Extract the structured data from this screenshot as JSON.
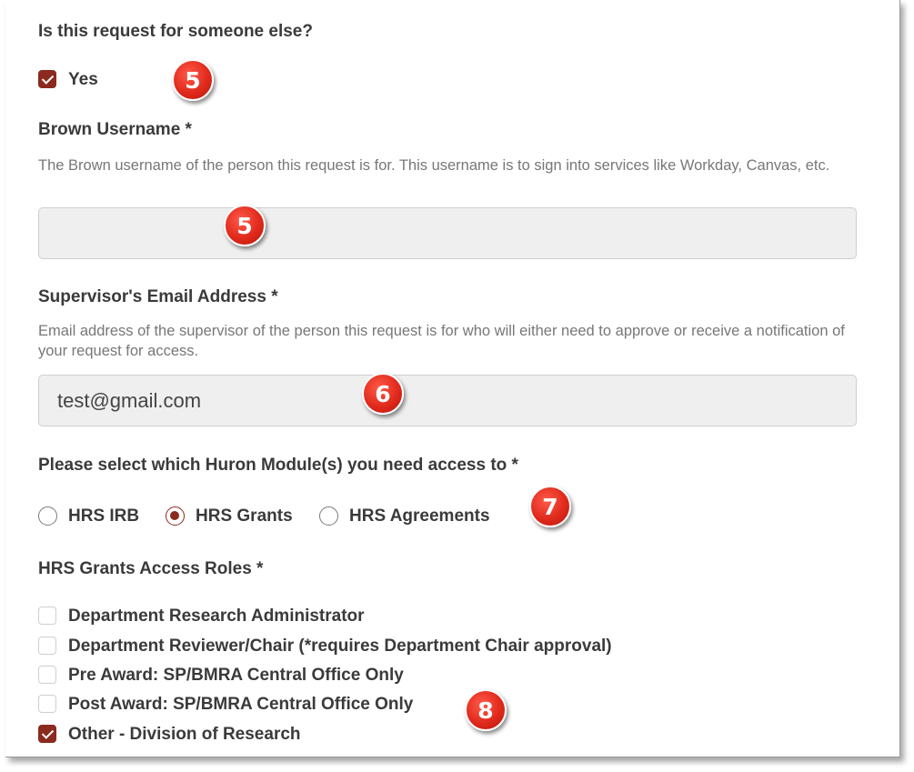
{
  "someone_else": {
    "question": "Is this request for someone else?",
    "option_label": "Yes",
    "checked": true
  },
  "brown_username": {
    "label": "Brown Username *",
    "help": "The Brown username of the person this request is for. This username is to sign into services like Workday, Canvas, etc.",
    "value": ""
  },
  "supervisor_email": {
    "label": "Supervisor's Email Address *",
    "help": "Email address of the supervisor of the person this request is for who will either need to approve or receive a notification of your request for access.",
    "value": "test@gmail.com"
  },
  "huron_modules": {
    "label": "Please select which Huron Module(s) you need access to *",
    "options": [
      {
        "label": "HRS IRB",
        "selected": false
      },
      {
        "label": "HRS Grants",
        "selected": true
      },
      {
        "label": "HRS Agreements",
        "selected": false
      }
    ]
  },
  "grants_roles": {
    "label": "HRS Grants Access Roles *",
    "options": [
      {
        "label": "Department Research Administrator",
        "checked": false
      },
      {
        "label": "Department Reviewer/Chair (*requires Department Chair approval)",
        "checked": false
      },
      {
        "label": "Pre Award: SP/BMRA Central Office Only",
        "checked": false
      },
      {
        "label": "Post Award: SP/BMRA Central Office Only",
        "checked": false
      },
      {
        "label": "Other - Division of Research",
        "checked": true
      }
    ]
  },
  "callouts": {
    "step_5a": "5",
    "step_5b": "5",
    "step_6": "6",
    "step_7": "7",
    "step_8": "8"
  },
  "colors": {
    "accent": "#8b2a1e",
    "callout": "#e02a1c",
    "field_bg": "#efefef"
  }
}
